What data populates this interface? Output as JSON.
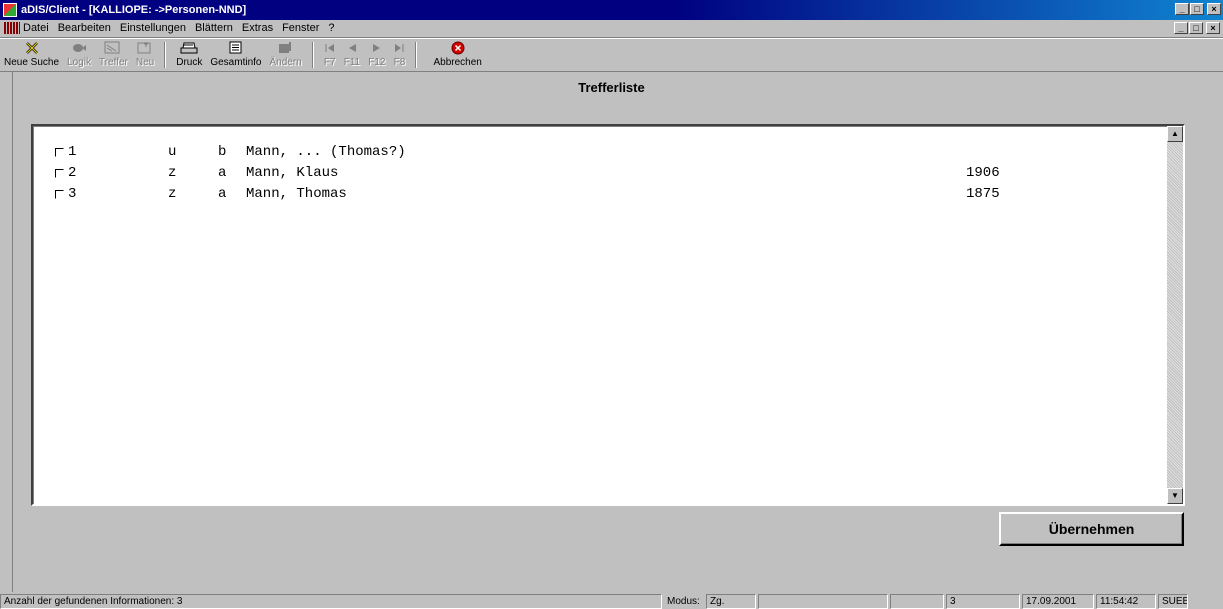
{
  "window": {
    "title": "aDIS/Client - [KALLIOPE: ->Personen-NND]",
    "min": "_",
    "max": "□",
    "close": "×"
  },
  "menu": [
    {
      "label": "Datei"
    },
    {
      "label": "Bearbeiten"
    },
    {
      "label": "Einstellungen"
    },
    {
      "label": "Blättern"
    },
    {
      "label": "Extras"
    },
    {
      "label": "Fenster"
    },
    {
      "label": "?"
    }
  ],
  "toolbar": {
    "neue_suche": "Neue Suche",
    "logik": "Logik",
    "treffer": "Treffer",
    "neu": "Neu",
    "druck": "Druck",
    "gesamtinfo": "Gesamtinfo",
    "aendern": "Ändern",
    "f7": "F7",
    "f11": "F11",
    "f12": "F12",
    "f8": "F8",
    "abbrechen": "Abbrechen"
  },
  "panel": {
    "title": "Trefferliste"
  },
  "results": [
    {
      "num": "1",
      "a": "u",
      "b": "b",
      "name": "Mann, ... (Thomas?)",
      "year": ""
    },
    {
      "num": "2",
      "a": "z",
      "b": "a",
      "name": "Mann, Klaus",
      "year": "1906"
    },
    {
      "num": "3",
      "a": "z",
      "b": "a",
      "name": "Mann, Thomas",
      "year": "1875"
    }
  ],
  "buttons": {
    "uebernehmen": "Übernehmen"
  },
  "status": {
    "info": "Anzahl der gefundenen Informationen: 3",
    "modus_label": "Modus:",
    "modus_value": "Zg.",
    "count": "3",
    "date": "17.09.2001",
    "time": "11:54:42",
    "user": "SUEB"
  },
  "icons": {
    "neue_suche": "x-icon",
    "logik": "logic-icon",
    "treffer": "hits-icon",
    "neu": "new-icon",
    "druck": "printer-icon",
    "gesamtinfo": "info-icon",
    "aendern": "edit-icon",
    "abbrechen": "stop-icon"
  },
  "colors": {
    "titlebar": "#000080",
    "face": "#c0c0c0",
    "abort": "#d40000"
  }
}
